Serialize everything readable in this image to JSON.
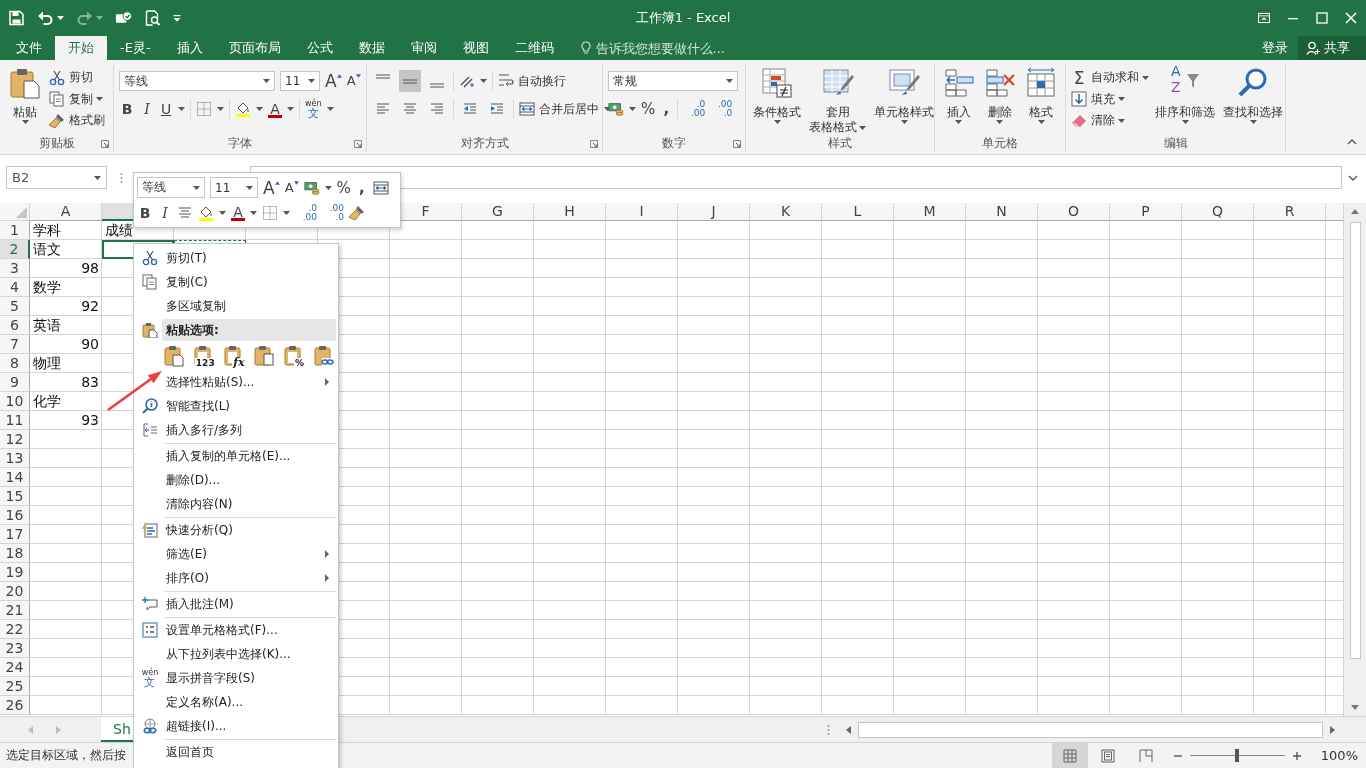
{
  "window": {
    "title": "工作簿1 - Excel"
  },
  "tabs": [
    {
      "label": "文件",
      "selected": false
    },
    {
      "label": "开始",
      "selected": true
    },
    {
      "label": "-E灵-",
      "selected": false
    },
    {
      "label": "插入",
      "selected": false
    },
    {
      "label": "页面布局",
      "selected": false
    },
    {
      "label": "公式",
      "selected": false
    },
    {
      "label": "数据",
      "selected": false
    },
    {
      "label": "审阅",
      "selected": false
    },
    {
      "label": "视图",
      "selected": false
    },
    {
      "label": "二维码",
      "selected": false
    }
  ],
  "tell_me": {
    "placeholder": "告诉我您想要做什么..."
  },
  "account": {
    "sign_in": "登录",
    "share": "共享"
  },
  "ribbon": {
    "clipboard": {
      "label": "剪贴板",
      "paste": "粘贴",
      "cut": "剪切",
      "copy": "复制",
      "format_painter": "格式刷"
    },
    "font": {
      "label": "字体",
      "font_name": "等线",
      "font_size": "11",
      "grow": "A",
      "shrink": "A",
      "bold": "B",
      "italic": "I",
      "underline": "U",
      "font_color": "A",
      "phonetic": [
        "wén",
        "文"
      ]
    },
    "alignment": {
      "label": "对齐方式",
      "vertical": [
        {
          "selected": false
        },
        {
          "selected": true
        },
        {
          "selected": false
        }
      ],
      "wrap": "自动换行",
      "merge": "合并后居中"
    },
    "number": {
      "label": "数字",
      "format": "常规",
      "percent": "%",
      "comma": ",",
      "increase_decimal": [
        ".0",
        ".00"
      ],
      "decrease_decimal": [
        ".00",
        ".0"
      ]
    },
    "styles": {
      "label": "样式",
      "conditional": "条件格式",
      "table_format": [
        "套用",
        "表格格式"
      ],
      "cell_styles": "单元格样式"
    },
    "cells": {
      "label": "单元格",
      "insert": "插入",
      "delete": "删除",
      "format": "格式"
    },
    "editing": {
      "label": "编辑",
      "autosum_glyph": "Σ",
      "autosum": "自动求和",
      "fill": "填充",
      "clear": "清除",
      "sort_glyphs": [
        "A",
        "Z"
      ],
      "sort": "排序和筛选",
      "find": "查找和选择"
    }
  },
  "name_box": {
    "value": "B2"
  },
  "mini_toolbar": {
    "font_name": "等线",
    "font_size": "11",
    "grow": "A",
    "shrink": "A",
    "percent": "%",
    "comma": ",",
    "bold": "B",
    "italic": "I",
    "font_color": "A",
    "increase_decimal": [
      ".0",
      ".00"
    ],
    "decrease_decimal": [
      ".00",
      ".0"
    ]
  },
  "sheet": {
    "columns": [
      {
        "kind": "header",
        "label": "A",
        "selected": false
      },
      {
        "kind": "header",
        "selected": true
      },
      {
        "kind": "covered"
      },
      {
        "kind": "covered"
      },
      {
        "kind": "covered"
      },
      {
        "kind": "header",
        "label": "F",
        "selected": false
      },
      {
        "kind": "header",
        "label": "G",
        "selected": false
      },
      {
        "kind": "header",
        "label": "H",
        "selected": false
      },
      {
        "kind": "header",
        "label": "I",
        "selected": false
      },
      {
        "kind": "header",
        "label": "J",
        "selected": false
      },
      {
        "kind": "header",
        "label": "K",
        "selected": false
      },
      {
        "kind": "header",
        "label": "L",
        "selected": false
      },
      {
        "kind": "header",
        "label": "M",
        "selected": false
      },
      {
        "kind": "header",
        "label": "N",
        "selected": false
      },
      {
        "kind": "header",
        "label": "O",
        "selected": false
      },
      {
        "kind": "header",
        "label": "P",
        "selected": false
      },
      {
        "kind": "header",
        "label": "Q",
        "selected": false
      },
      {
        "kind": "header",
        "label": "R",
        "selected": false
      }
    ],
    "rows": [
      {
        "header": "1",
        "selected": false,
        "cells": [
          {
            "text": "学科",
            "kind": "text",
            "selected": false
          },
          {
            "text": "成绩",
            "kind": "text",
            "selected": false
          }
        ]
      },
      {
        "header": "2",
        "selected": true,
        "cells": [
          {
            "text": "语文",
            "kind": "text",
            "selected": false
          },
          {
            "kind": "empty",
            "selected": true
          },
          {
            "kind": "copy-range"
          }
        ]
      },
      {
        "header": "3",
        "selected": false,
        "cells": [
          {
            "text": "98",
            "kind": "number",
            "selected": false
          }
        ]
      },
      {
        "header": "4",
        "selected": false,
        "cells": [
          {
            "text": "数学",
            "kind": "text",
            "selected": false
          }
        ]
      },
      {
        "header": "5",
        "selected": false,
        "cells": [
          {
            "text": "92",
            "kind": "number",
            "selected": false
          }
        ]
      },
      {
        "header": "6",
        "selected": false,
        "cells": [
          {
            "text": "英语",
            "kind": "text",
            "selected": false
          }
        ]
      },
      {
        "header": "7",
        "selected": false,
        "cells": [
          {
            "text": "90",
            "kind": "number",
            "selected": false
          }
        ]
      },
      {
        "header": "8",
        "selected": false,
        "cells": [
          {
            "text": "物理",
            "kind": "text",
            "selected": false
          }
        ]
      },
      {
        "header": "9",
        "selected": false,
        "cells": [
          {
            "text": "83",
            "kind": "number",
            "selected": false
          }
        ]
      },
      {
        "header": "10",
        "selected": false,
        "cells": [
          {
            "text": "化学",
            "kind": "text",
            "selected": false
          }
        ]
      },
      {
        "header": "11",
        "selected": false,
        "cells": [
          {
            "text": "93",
            "kind": "number",
            "selected": false
          }
        ]
      },
      {
        "header": "12",
        "selected": false
      },
      {
        "header": "13",
        "selected": false
      },
      {
        "header": "14",
        "selected": false
      },
      {
        "header": "15",
        "selected": false
      },
      {
        "header": "16",
        "selected": false
      },
      {
        "header": "17",
        "selected": false
      },
      {
        "header": "18",
        "selected": false
      },
      {
        "header": "19",
        "selected": false
      },
      {
        "header": "20",
        "selected": false
      },
      {
        "header": "21",
        "selected": false
      },
      {
        "header": "22",
        "selected": false
      },
      {
        "header": "23",
        "selected": false
      },
      {
        "header": "24",
        "selected": false
      },
      {
        "header": "25",
        "selected": false
      },
      {
        "header": "26",
        "selected": false
      }
    ]
  },
  "context_menu": {
    "items": [
      {
        "kind": "cut",
        "label": "剪切(T)",
        "submenu": false
      },
      {
        "kind": "copy",
        "label": "复制(C)",
        "submenu": false
      },
      {
        "kind": "plain",
        "label": "多区域复制",
        "submenu": false
      },
      {
        "kind": "paste-header",
        "label": "粘贴选项:"
      },
      {
        "kind": "paste-options",
        "options": [
          {
            "kind": "paste"
          },
          {
            "kind": "values",
            "glyph": "123"
          },
          {
            "kind": "formulas",
            "glyph": "fx"
          },
          {
            "kind": "transpose"
          },
          {
            "kind": "formatting",
            "glyph": "%"
          },
          {
            "kind": "link"
          }
        ]
      },
      {
        "kind": "plain",
        "label": "选择性粘贴(S)...",
        "submenu": true
      },
      {
        "kind": "lookup",
        "label": "智能查找(L)",
        "submenu": false
      },
      {
        "kind": "insert-rows",
        "label": "插入多行/多列",
        "submenu": false
      },
      {
        "kind": "separator"
      },
      {
        "kind": "plain",
        "label": "插入复制的单元格(E)...",
        "submenu": false
      },
      {
        "kind": "plain",
        "label": "删除(D)...",
        "submenu": false
      },
      {
        "kind": "plain",
        "label": "清除内容(N)",
        "submenu": false
      },
      {
        "kind": "separator"
      },
      {
        "kind": "analysis",
        "label": "快速分析(Q)",
        "submenu": false
      },
      {
        "kind": "plain",
        "label": "筛选(E)",
        "submenu": true
      },
      {
        "kind": "plain",
        "label": "排序(O)",
        "submenu": true
      },
      {
        "kind": "separator"
      },
      {
        "kind": "comment",
        "label": "插入批注(M)",
        "submenu": false
      },
      {
        "kind": "separator"
      },
      {
        "kind": "format",
        "label": "设置单元格格式(F)...",
        "submenu": false
      },
      {
        "kind": "plain",
        "label": "从下拉列表中选择(K)...",
        "submenu": false
      },
      {
        "kind": "phonetic",
        "label": "显示拼音字段(S)",
        "submenu": false,
        "icon_text": [
          "wén",
          "文"
        ]
      },
      {
        "kind": "plain",
        "label": "定义名称(A)...",
        "submenu": false
      },
      {
        "kind": "hyperlink",
        "label": "超链接(I)...",
        "submenu": false
      },
      {
        "kind": "separator"
      },
      {
        "kind": "plain",
        "label": "返回首页",
        "submenu": false
      }
    ]
  },
  "sheet_tabs": [
    {
      "label": "Sh",
      "selected": true
    }
  ],
  "status_bar": {
    "message": "选定目标区域，然后按",
    "views": [
      {
        "selected": true
      },
      {
        "selected": false
      },
      {
        "selected": false
      }
    ],
    "zoom": {
      "level": 0.5,
      "reading": "100%"
    }
  }
}
